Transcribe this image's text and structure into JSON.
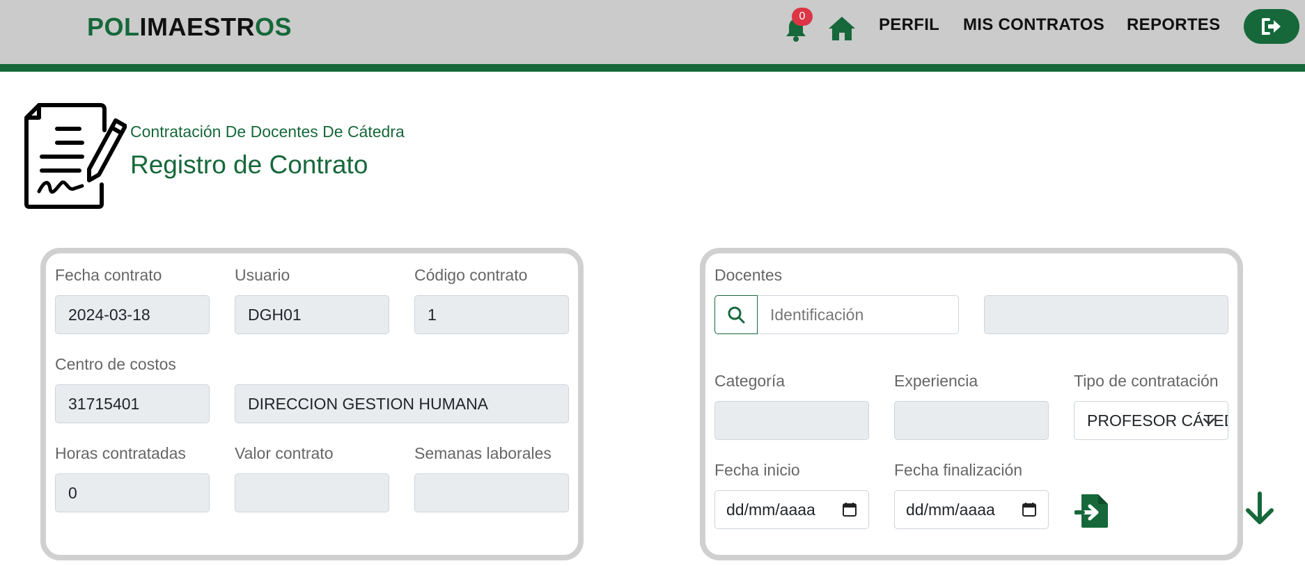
{
  "header": {
    "brand_prefix": "POL",
    "brand_rest": "IMAESTR",
    "brand_suffix": "OS",
    "notification_count": "0",
    "nav": [
      "PERFIL",
      "MIS CONTRATOS",
      "REPORTES"
    ],
    "accent_color": "#16683a"
  },
  "page": {
    "subtitle": "Contratación De Docentes De Cátedra",
    "title": "Registro de Contrato"
  },
  "left_card": {
    "fecha_contrato_label": "Fecha contrato",
    "fecha_contrato_value": "2024-03-18",
    "usuario_label": "Usuario",
    "usuario_value": "DGH01",
    "codigo_label": "Código contrato",
    "codigo_value": "1",
    "centro_label": "Centro de costos",
    "centro_code": "31715401",
    "centro_name": "DIRECCION GESTION HUMANA",
    "horas_label": "Horas contratadas",
    "horas_value": "0",
    "valor_label": "Valor contrato",
    "valor_value": "",
    "semanas_label": "Semanas laborales",
    "semanas_value": ""
  },
  "right_card": {
    "docentes_label": "Docentes",
    "identificacion_placeholder": "Identificación",
    "docente_name_value": "",
    "categoria_label": "Categoría",
    "categoria_value": "",
    "experiencia_label": "Experiencia",
    "experiencia_value": "",
    "tipo_label": "Tipo de contratación",
    "tipo_value": "PROFESOR CÁTEDRA",
    "fecha_inicio_label": "Fecha inicio",
    "fecha_inicio_placeholder": "dd/mm/aaaa",
    "fecha_fin_label": "Fecha finalización",
    "fecha_fin_placeholder": "dd/mm/aaaa"
  },
  "icons": {
    "bell": "bell-icon",
    "home": "home-icon",
    "logout": "sign-out-icon",
    "document": "contract-signature-icon",
    "search": "search-icon",
    "chevron": "chevron-down-icon",
    "calendar": "calendar-icon",
    "file_import": "file-import-icon",
    "arrow_down": "arrow-down-icon"
  }
}
